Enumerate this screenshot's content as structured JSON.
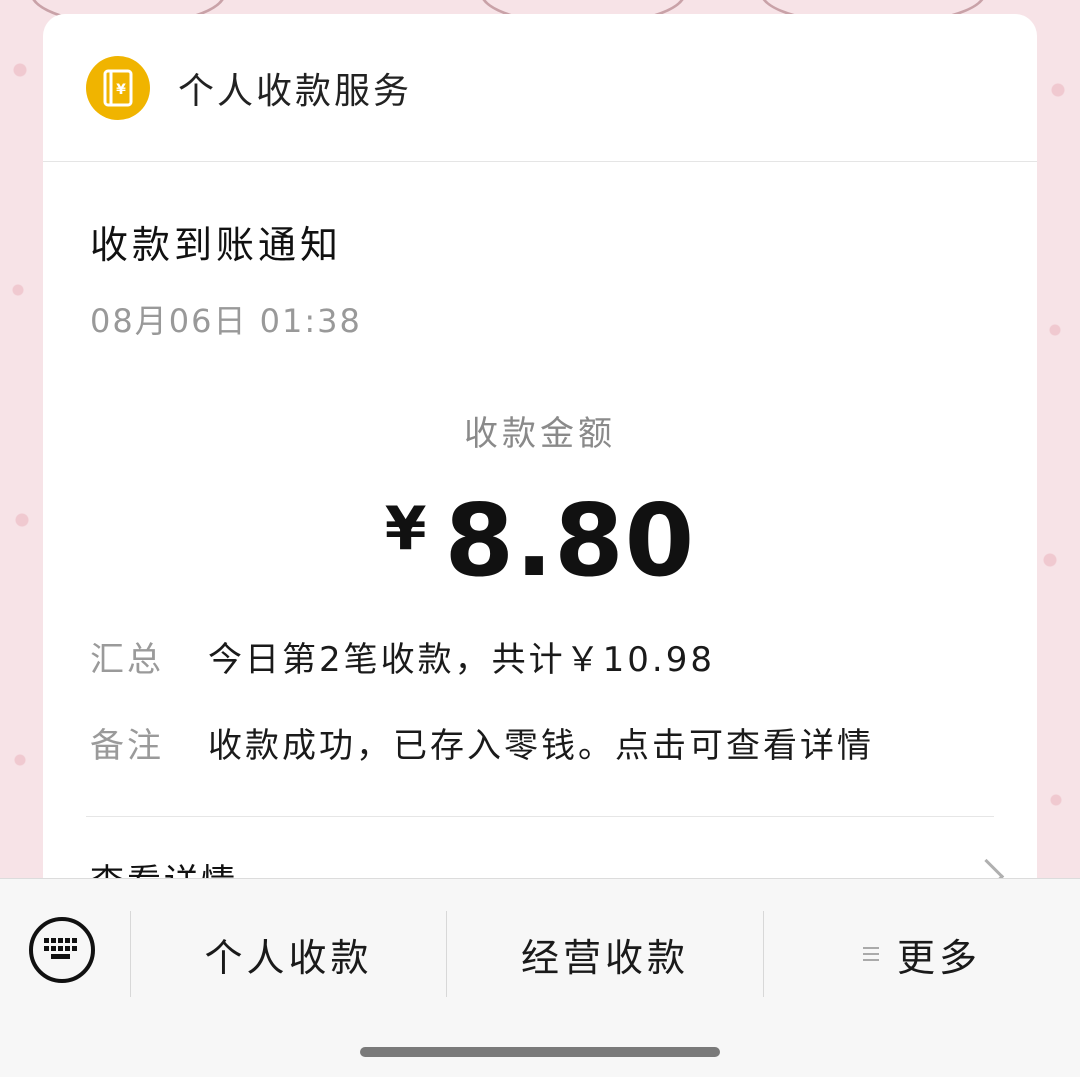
{
  "header": {
    "service_name": "个人收款服务",
    "icon": "ledger-yen-icon",
    "accent": "#f0b400"
  },
  "notification": {
    "title": "收款到账通知",
    "time": "08月06日 01:38",
    "amount_label": "收款金额",
    "currency": "¥",
    "amount": "8.80",
    "rows": [
      {
        "key": "汇总",
        "value": "今日第2笔收款，共计￥10.98"
      },
      {
        "key": "备注",
        "value": "收款成功，已存入零钱。点击可查看详情"
      }
    ],
    "details_link": "查看详情"
  },
  "bottom_menu": {
    "items": [
      {
        "label": "个人收款"
      },
      {
        "label": "经营收款"
      },
      {
        "label": "更多"
      }
    ],
    "keyboard_icon": "keyboard-icon",
    "more_icon": "menu-lines-icon"
  }
}
